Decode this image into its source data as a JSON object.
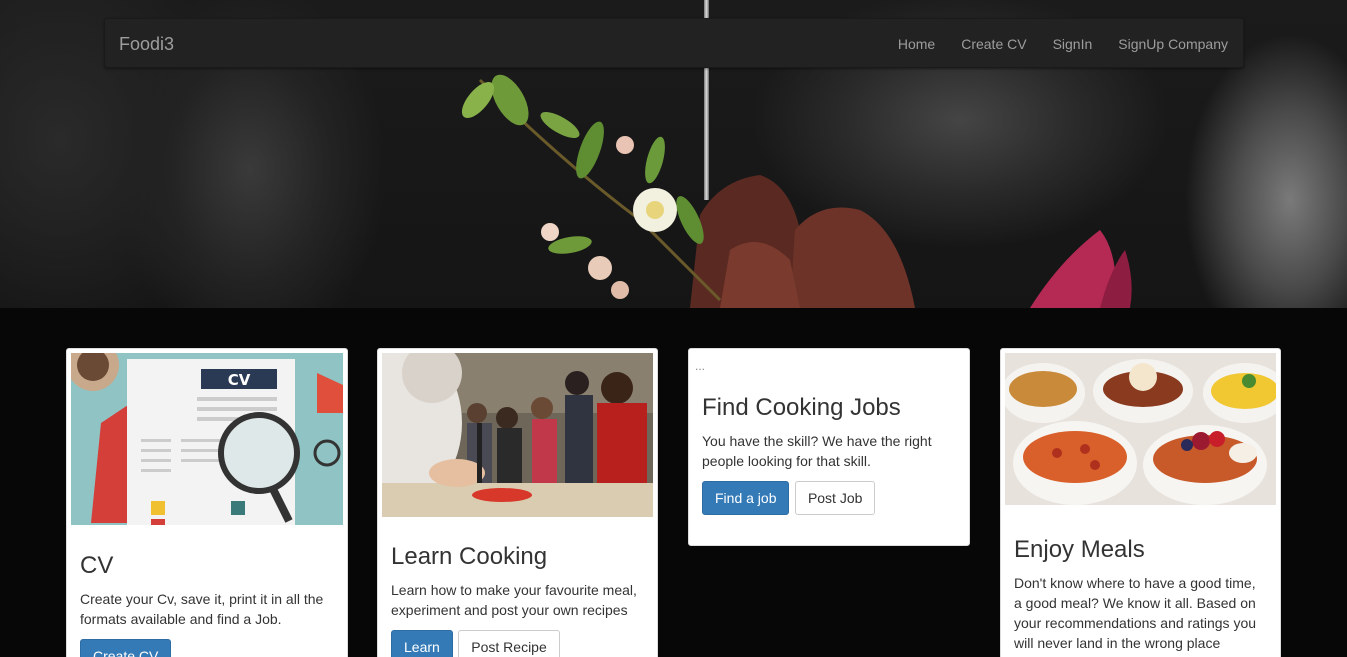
{
  "navbar": {
    "brand": "Foodi3",
    "links": [
      "Home",
      "Create CV",
      "SignIn",
      "SignUp Company"
    ]
  },
  "cards": [
    {
      "title": "CV",
      "text": "Create your Cv, save it, print it in all the formats available and find a Job.",
      "buttons": [
        "Create CV"
      ],
      "image": "cv-illustration"
    },
    {
      "title": "Learn Cooking",
      "text": "Learn how to make your favourite meal, experiment and post your own recipes",
      "buttons": [
        "Learn",
        "Post Recipe"
      ],
      "image": "cooking-class-photo"
    },
    {
      "title": "Find Cooking Jobs",
      "text": "You have the skill? We have the right people looking for that skill.",
      "buttons": [
        "Find a job",
        "Post Job"
      ],
      "image_alt": "..."
    },
    {
      "title": "Enjoy Meals",
      "text": "Don't know where to have a good time, a good meal? We know it all. Based on your recommendations and ratings you will never land in the wrong place",
      "buttons": [],
      "image": "meals-bowls-photo"
    }
  ],
  "colors": {
    "primary": "#337ab7",
    "navbar_bg": "#222222",
    "page_bg": "#070707"
  }
}
